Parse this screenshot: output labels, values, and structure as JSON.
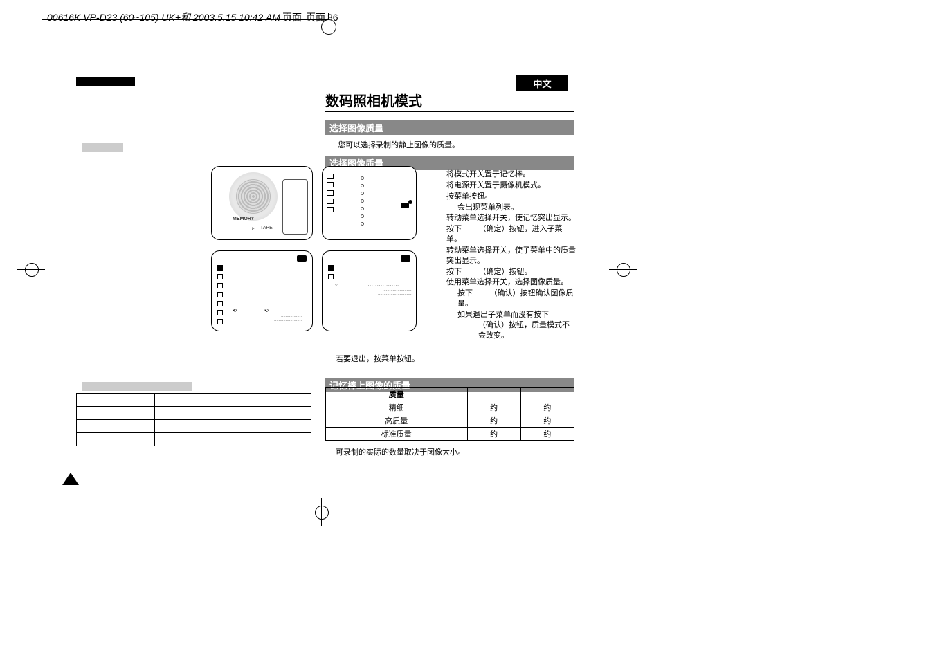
{
  "header": {
    "text": "00616K VP-D23 (60~105) UK+和 2003.5.15 10:42 AM",
    "page_label": "页面",
    "page_num": "86"
  },
  "lang_tag": "中文",
  "main_title": "数码照相机模式",
  "section1": "选择图像质量",
  "intro": "您可以选择录制的静止图像的质量。",
  "section2": "选择图像质量",
  "camera_labels": {
    "memory": "MEMORY",
    "tape": "TAPE"
  },
  "steps": {
    "s1": "将模式开关置于记忆棒。",
    "s2": "将电源开关置于摄像机模式。",
    "s3": "按菜单按钮。",
    "s3a": "会出现菜单列表。",
    "s4": "转动菜单选择开关，使记忆突出显示。",
    "s5a": "按下",
    "s5b": "（确定）按钮，进入子菜单。",
    "s6": "转动菜单选择开关，使子菜单中的质量突出显示。",
    "s7a": "按下",
    "s7b": "（确定）按钮。",
    "s8": "使用菜单选择开关，选择图像质量。",
    "s9a": "按下",
    "s9b": "（确认）按钮确认图像质量。",
    "s10a": "如果退出子菜单而没有按下",
    "s10b": "（确认）按钮，质量模式不会改变。"
  },
  "exit_line": "若要退出，按菜单按钮。",
  "section3": "记忆棒上图像的质量",
  "table": {
    "h1": "质量",
    "r1c1": "精细",
    "r1c2": "约",
    "r1c3": "约",
    "r2c1": "高质量",
    "r2c2": "约",
    "r2c3": "约",
    "r3c1": "标准质量",
    "r3c2": "约",
    "r3c3": "约"
  },
  "table_note": "可录制的实际的数量取决于图像大小。"
}
